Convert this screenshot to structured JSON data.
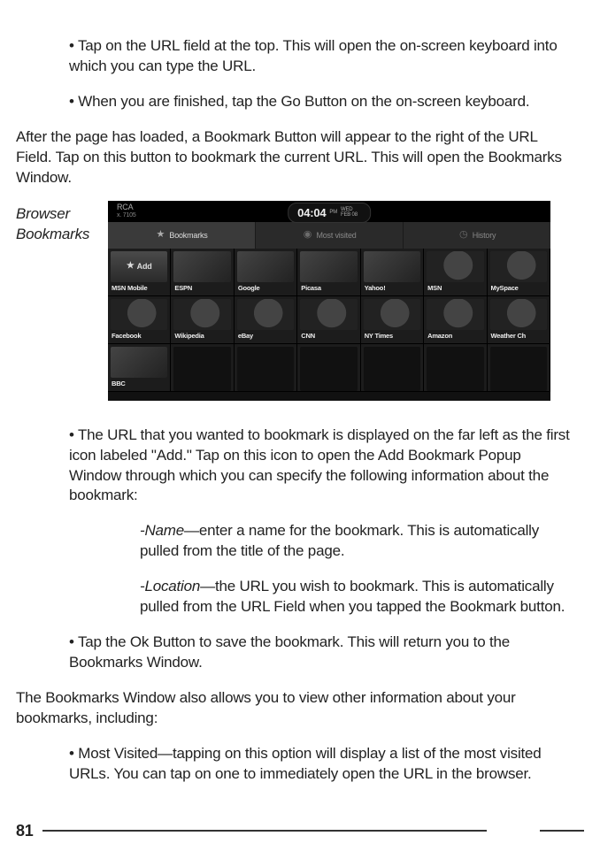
{
  "bullets": {
    "b1": "• Tap on the URL field at the top. This will open the on-screen keyboard into which you can type the URL.",
    "b2": "• When you are finished, tap the Go Button on the on-screen keyboard.",
    "p1": "After the page has loaded, a Bookmark Button will appear to the right of the URL Field. Tap on this button to bookmark the current URL. This will open the Bookmarks Window.",
    "caption": "Browser Bookmarks",
    "b3": "• The URL that you wanted to bookmark is displayed on the far left as the first icon labeled \"Add.\" Tap on this icon to open the Add Bookmark Popup Window through which you can specify the following information about the bookmark:",
    "name_lead": "-Name",
    "name_rest": "—enter a name for the bookmark. This is automatically pulled from the title of the page.",
    "loc_lead": "-Location",
    "loc_rest": "—the URL you wish to bookmark. This is automatically pulled from the URL Field when you tapped the Bookmark button.",
    "b4": "• Tap the Ok Button to save the bookmark. This will return you to the Bookmarks Window.",
    "p2": "The Bookmarks Window also allows you to view other information about your bookmarks, including:",
    "b5": "• Most Visited—tapping on this option will display a list of the most visited URLs. You can tap on one to immediately open the URL in the browser."
  },
  "page_number": "81",
  "shot": {
    "brand": "RCA",
    "model": "x. 7105",
    "time": "04:04",
    "ampm": "PM",
    "dow": "WED",
    "date": "FEB 08",
    "tabs": {
      "bookmarks": "Bookmarks",
      "most": "Most visited",
      "history": "History"
    },
    "add_label": "Add",
    "cells": {
      "r1": [
        "MSN Mobile",
        "ESPN",
        "Google",
        "Picasa",
        "Yahoo!",
        "MSN",
        "MySpace"
      ],
      "r2": [
        "Facebook",
        "Wikipedia",
        "eBay",
        "CNN",
        "NY Times",
        "Amazon",
        "Weather Ch"
      ],
      "r3_first": "BBC"
    }
  }
}
